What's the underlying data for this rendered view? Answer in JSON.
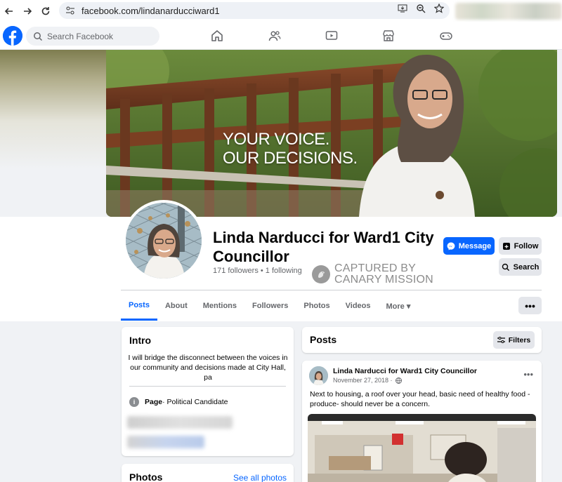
{
  "browser": {
    "url": "facebook.com/lindanarducciward1"
  },
  "fbnav": {
    "search_placeholder": "Search Facebook"
  },
  "cover": {
    "line1": "YOUR VOICE.",
    "line2": "OUR DECISIONS."
  },
  "profile": {
    "name": "Linda Narducci for Ward1 City Councillor",
    "stats": "171 followers • 1 following",
    "message_label": "Message",
    "follow_label": "Follow",
    "search_label": "Search",
    "more_label": "•••"
  },
  "watermark": {
    "line1": "CAPTURED BY",
    "line2": "CANARY MISSION"
  },
  "tabs": [
    {
      "label": "Posts"
    },
    {
      "label": "About"
    },
    {
      "label": "Mentions"
    },
    {
      "label": "Followers"
    },
    {
      "label": "Photos"
    },
    {
      "label": "Videos"
    },
    {
      "label": "More ▾"
    }
  ],
  "intro": {
    "title": "Intro",
    "bio": "I will bridge the disconnect between the voices in our community and decisions made at City Hall, pa",
    "category_bold": "Page",
    "category_rest": " · Political Candidate"
  },
  "photos": {
    "title": "Photos",
    "see_all": "See all photos"
  },
  "posts": {
    "title": "Posts",
    "filters_label": "Filters"
  },
  "post": {
    "author": "Linda Narducci for Ward1 City Councillor",
    "date": "November 27, 2018 ·",
    "text": "Next to housing, a roof over your head, basic need of healthy food - produce- should never be a concern.",
    "menu": "•••"
  },
  "colors": {
    "facebook_blue": "#0866ff",
    "button_grey": "#e4e6eb",
    "page_bg": "#f0f2f5"
  }
}
